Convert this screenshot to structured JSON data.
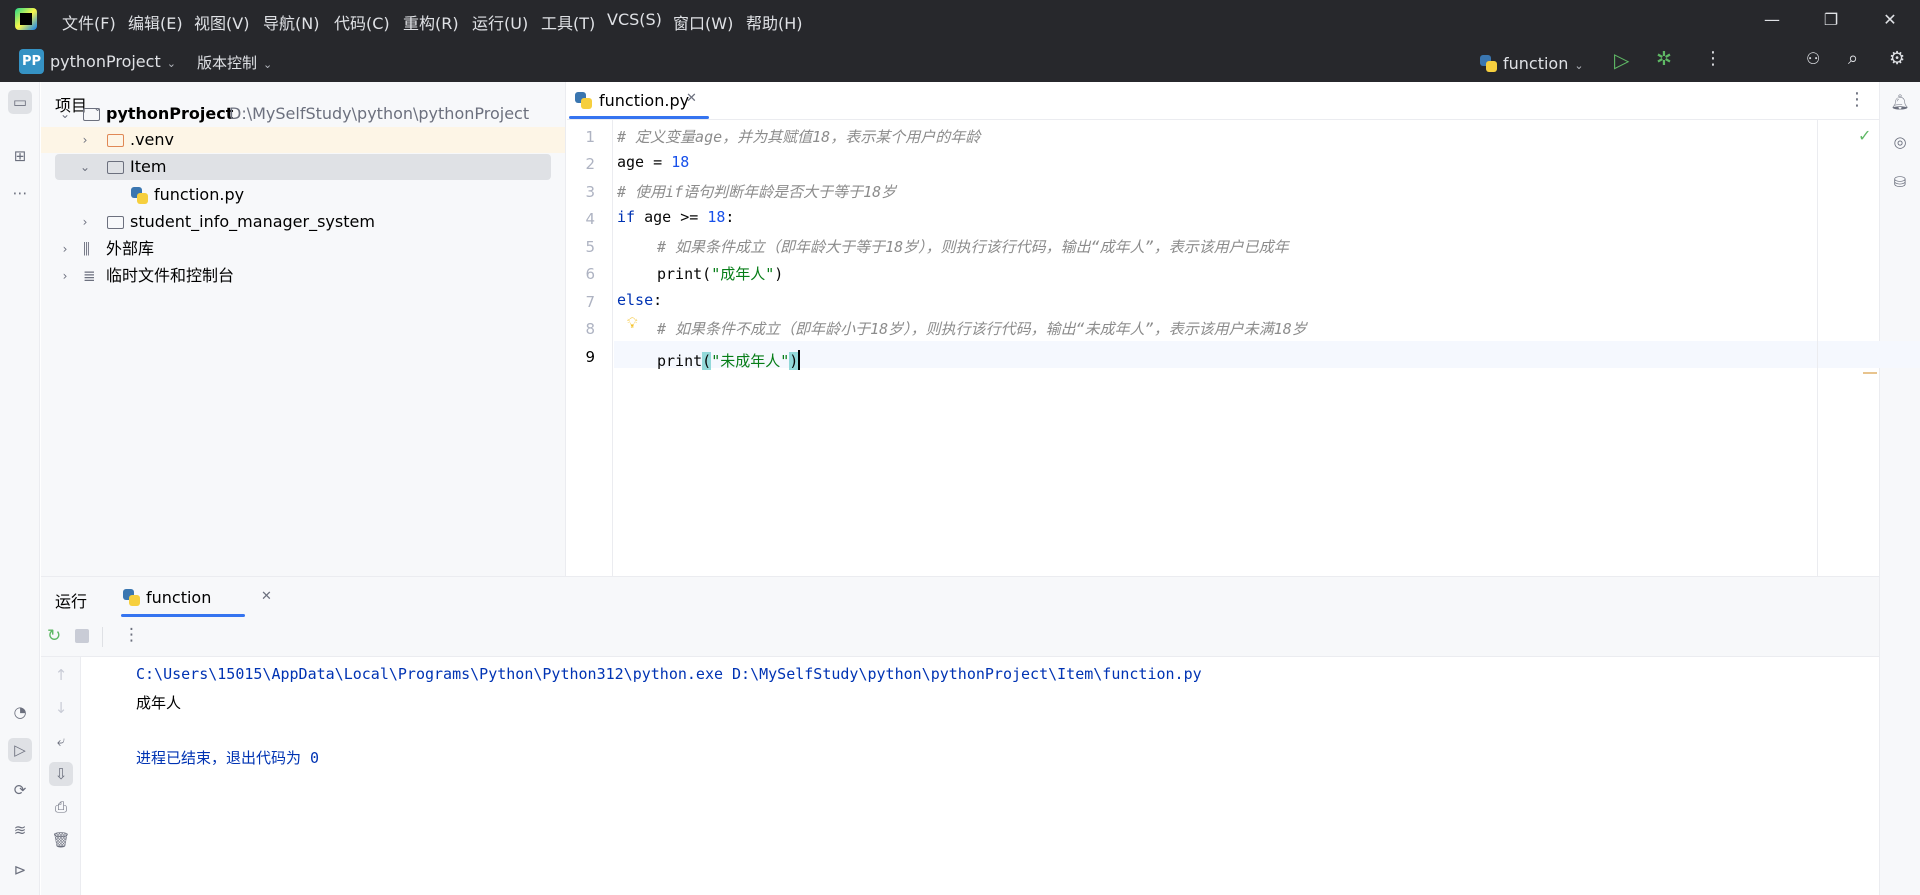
{
  "menu": {
    "items": [
      "文件(F)",
      "编辑(E)",
      "视图(V)",
      "导航(N)",
      "代码(C)",
      "重构(R)",
      "运行(U)",
      "工具(T)",
      "VCS(S)",
      "窗口(W)",
      "帮助(H)"
    ]
  },
  "projectbar": {
    "badge": "PP",
    "project_name": "pythonProject",
    "vcs_label": "版本控制",
    "run_config": "function"
  },
  "project_panel": {
    "title": "项目",
    "root_name": "pythonProject",
    "root_path": "D:\\MySelfStudy\\python\\pythonProject",
    "items": [
      ".venv",
      "Item",
      "function.py",
      "student_info_manager_system",
      "外部库",
      "临时文件和控制台"
    ]
  },
  "editor": {
    "tab_label": "function.py",
    "line_numbers": [
      "1",
      "2",
      "3",
      "4",
      "5",
      "6",
      "7",
      "8",
      "9"
    ],
    "lines": {
      "l1": "# 定义变量age，并为其赋值18，表示某个用户的年龄",
      "l2_var": "age",
      "l2_op": " = ",
      "l2_num": "18",
      "l3": "# 使用if语句判断年龄是否大于等于18岁",
      "l4_kw": "if",
      "l4_mid": " age >= ",
      "l4_num": "18",
      "l4_end": ":",
      "l5": "# 如果条件成立（即年龄大于等于18岁），则执行该行代码，输出“成年人”，表示该用户已成年",
      "l6_fn": "print(",
      "l6_str": "\"成年人\"",
      "l6_end": ")",
      "l7_kw": "else",
      "l7_end": ":",
      "l8": "# 如果条件不成立（即年龄小于18岁），则执行该行代码，输出“未成年人”，表示该用户未满18岁",
      "l9_fn": "print",
      "l9_open": "(",
      "l9_str": "\"未成年人\"",
      "l9_close": ")"
    }
  },
  "run_panel": {
    "tab_run": "运行",
    "tab_config": "function",
    "output": {
      "command": "C:\\Users\\15015\\AppData\\Local\\Programs\\Python\\Python312\\python.exe D:\\MySelfStudy\\python\\pythonProject\\Item\\function.py",
      "result": "成年人",
      "exit_message": "进程已结束，退出代码为 0"
    }
  },
  "colors": {
    "titlebar_bg": "#27282c",
    "accent": "#3574f0",
    "comment": "#8c8c8c",
    "keyword": "#0033b3",
    "number": "#1750eb",
    "string": "#067d17"
  }
}
